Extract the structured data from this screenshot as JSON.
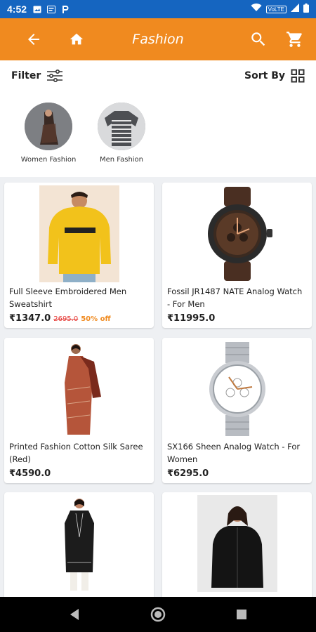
{
  "status_bar": {
    "time": "4:52",
    "network_label": "VoLTE"
  },
  "app_bar": {
    "title": "Fashion"
  },
  "toolbar": {
    "filter_label": "Filter",
    "sort_label": "Sort By"
  },
  "categories": [
    {
      "label": "Women Fashion"
    },
    {
      "label": "Men Fashion"
    }
  ],
  "products": [
    {
      "name": "Full Sleeve Embroidered Men Sweatshirt",
      "price": "₹1347.0",
      "mrp": "2695.0",
      "discount": "50% off",
      "image": "yellow-hoodie"
    },
    {
      "name": "Fossil JR1487 NATE Analog Watch - For Men",
      "price": "₹11995.0",
      "mrp": "",
      "discount": "",
      "image": "brown-watch"
    },
    {
      "name": "Printed Fashion Cotton Silk Saree (Red)",
      "price": "₹4590.0",
      "mrp": "",
      "discount": "",
      "image": "red-saree"
    },
    {
      "name": "SX166 Sheen Analog Watch - For Women",
      "price": "₹6295.0",
      "mrp": "",
      "discount": "",
      "image": "silver-watch"
    },
    {
      "name": "",
      "price": "",
      "mrp": "",
      "discount": "",
      "image": "black-kurta"
    },
    {
      "name": "",
      "price": "",
      "mrp": "",
      "discount": "",
      "image": "black-jacket"
    }
  ],
  "colors": {
    "status_bar": "#1565c0",
    "app_bar": "#f08a1f",
    "discount": "#f08a1f",
    "strike_price": "#e53935"
  }
}
